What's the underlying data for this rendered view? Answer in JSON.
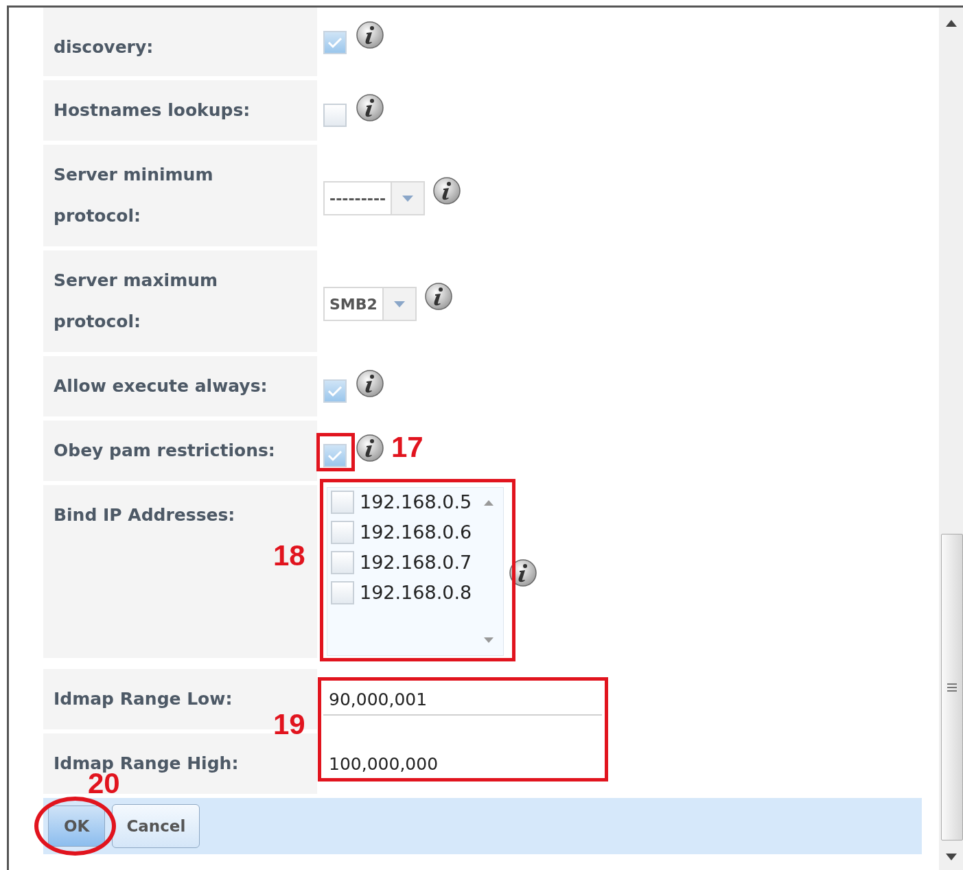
{
  "rows": [
    {
      "label": "discovery:",
      "kind": "checkbox",
      "checked": true
    },
    {
      "label": "Hostnames lookups:",
      "kind": "checkbox",
      "checked": false
    },
    {
      "label": "Server minimum protocol:",
      "kind": "select",
      "value": "---------"
    },
    {
      "label": "Server maximum protocol:",
      "kind": "select",
      "value": "SMB2"
    },
    {
      "label": "Allow execute always:",
      "kind": "checkbox",
      "checked": true
    },
    {
      "label": "Obey pam restrictions:",
      "kind": "checkbox",
      "checked": true
    },
    {
      "label": "Bind IP Addresses:",
      "kind": "multiselect",
      "options": [
        {
          "label": "192.168.0.5",
          "checked": false
        },
        {
          "label": "192.168.0.6",
          "checked": false
        },
        {
          "label": "192.168.0.7",
          "checked": false
        },
        {
          "label": "192.168.0.8",
          "checked": false
        }
      ]
    },
    {
      "label": "Idmap Range Low:",
      "kind": "text",
      "value": "90,000,001"
    },
    {
      "label": "Idmap Range High:",
      "kind": "text",
      "value": "100,000,000"
    }
  ],
  "buttons": [
    {
      "label": "OK",
      "kind": "primary"
    },
    {
      "label": "Cancel",
      "kind": "secondary"
    }
  ],
  "annotations": [
    {
      "label": "17",
      "kind": "box"
    },
    {
      "label": "18",
      "kind": "box"
    },
    {
      "label": "19",
      "kind": "box"
    },
    {
      "label": "20",
      "kind": "ellipse"
    }
  ]
}
